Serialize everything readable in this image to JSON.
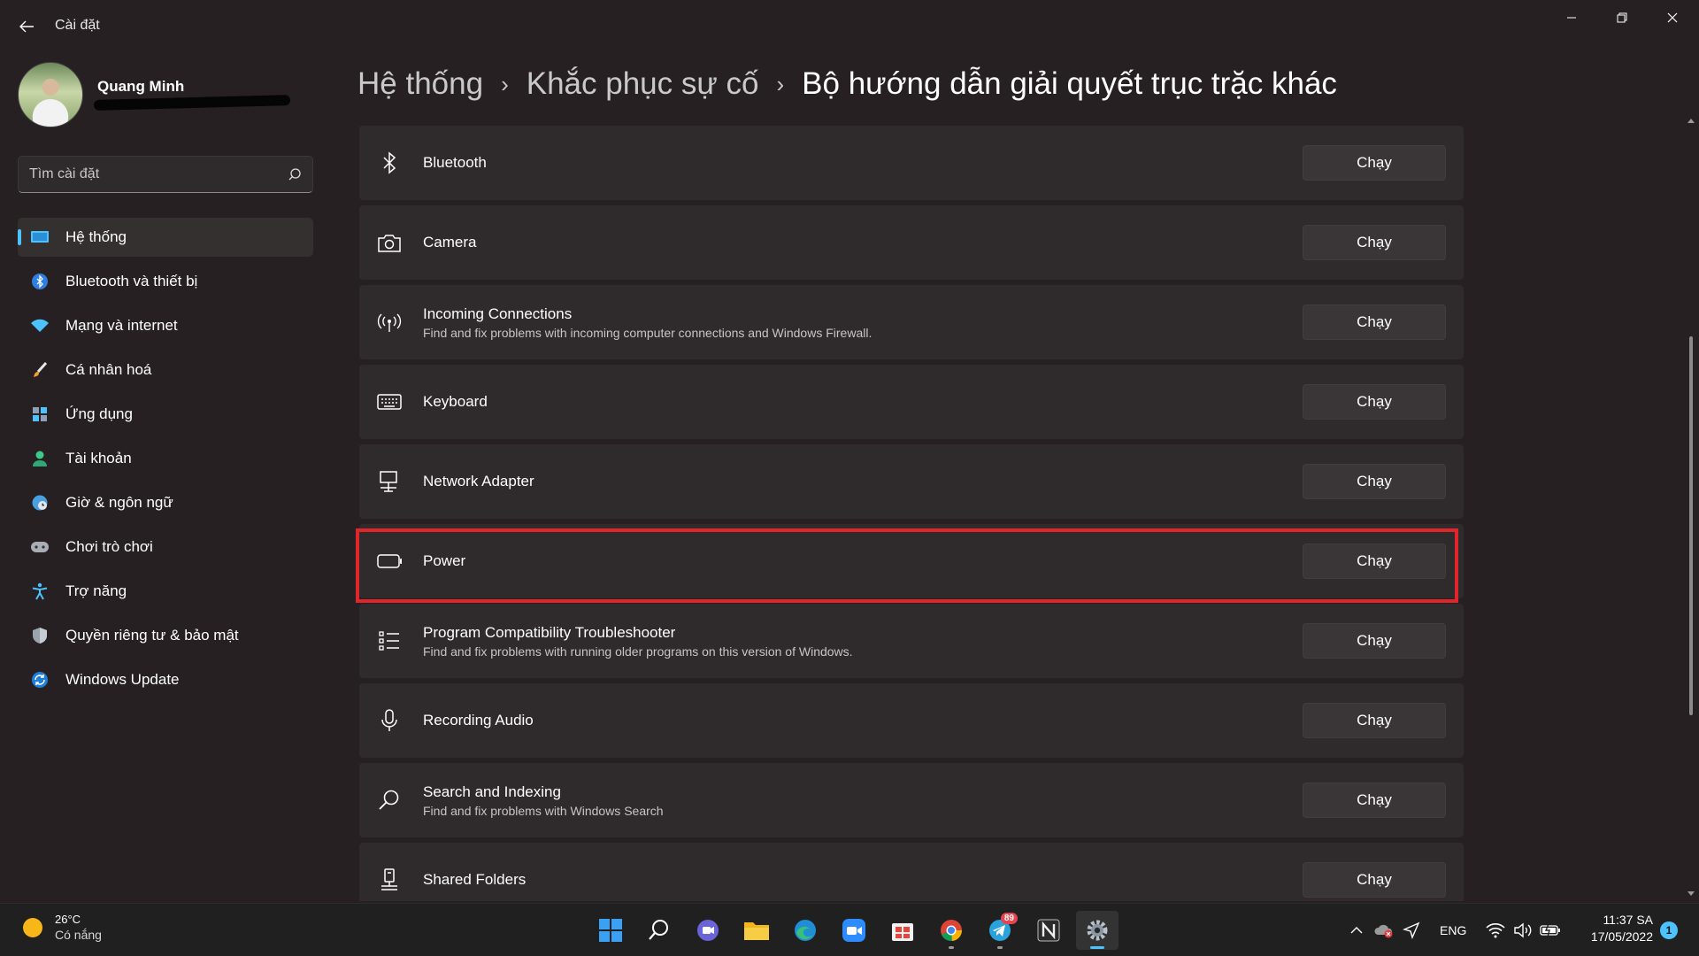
{
  "window": {
    "title": "Cài đặt"
  },
  "profile": {
    "name": "Quang Minh"
  },
  "search": {
    "placeholder": "Tìm cài đặt"
  },
  "nav": {
    "items": [
      {
        "label": "Hệ thống",
        "icon": "monitor-icon",
        "active": true
      },
      {
        "label": "Bluetooth và thiết bị",
        "icon": "bluetooth-icon"
      },
      {
        "label": "Mạng và internet",
        "icon": "wifi-icon"
      },
      {
        "label": "Cá nhân hoá",
        "icon": "brush-icon"
      },
      {
        "label": "Ứng dụng",
        "icon": "apps-icon"
      },
      {
        "label": "Tài khoản",
        "icon": "person-icon"
      },
      {
        "label": "Giờ & ngôn ngữ",
        "icon": "globe-clock-icon"
      },
      {
        "label": "Chơi trò chơi",
        "icon": "gamepad-icon"
      },
      {
        "label": "Trợ năng",
        "icon": "accessibility-icon"
      },
      {
        "label": "Quyền riêng tư & bảo mật",
        "icon": "shield-icon"
      },
      {
        "label": "Windows Update",
        "icon": "update-icon"
      }
    ]
  },
  "breadcrumb": {
    "items": [
      "Hệ thống",
      "Khắc phục sự cố",
      "Bộ hướng dẫn giải quyết trục trặc khác"
    ],
    "separator": "›"
  },
  "troubleshooters": [
    {
      "title": "Bluetooth",
      "desc": "",
      "icon": "bluetooth-icon",
      "button": "Chạy"
    },
    {
      "title": "Camera",
      "desc": "",
      "icon": "camera-icon",
      "button": "Chạy"
    },
    {
      "title": "Incoming Connections",
      "desc": "Find and fix problems with incoming computer connections and Windows Firewall.",
      "icon": "antenna-icon",
      "button": "Chạy"
    },
    {
      "title": "Keyboard",
      "desc": "",
      "icon": "keyboard-icon",
      "button": "Chạy"
    },
    {
      "title": "Network Adapter",
      "desc": "",
      "icon": "network-adapter-icon",
      "button": "Chạy"
    },
    {
      "title": "Power",
      "desc": "",
      "icon": "battery-icon",
      "button": "Chạy",
      "highlighted": true
    },
    {
      "title": "Program Compatibility Troubleshooter",
      "desc": "Find and fix problems with running older programs on this version of Windows.",
      "icon": "list-icon",
      "button": "Chạy"
    },
    {
      "title": "Recording Audio",
      "desc": "",
      "icon": "microphone-icon",
      "button": "Chạy"
    },
    {
      "title": "Search and Indexing",
      "desc": "Find and fix problems with Windows Search",
      "icon": "search-icon",
      "button": "Chạy"
    },
    {
      "title": "Shared Folders",
      "desc": "",
      "icon": "shared-folder-icon",
      "button": "Chạy"
    }
  ],
  "taskbar": {
    "weather": {
      "temp": "26°C",
      "condition": "Có nắng"
    },
    "apps": [
      {
        "name": "start-button",
        "icon": "windows-logo-icon"
      },
      {
        "name": "search-button",
        "icon": "search-icon"
      },
      {
        "name": "teams-chat",
        "icon": "chat-icon"
      },
      {
        "name": "file-explorer",
        "icon": "folder-icon"
      },
      {
        "name": "edge-browser",
        "icon": "edge-icon"
      },
      {
        "name": "zoom-app",
        "icon": "video-camera-icon"
      },
      {
        "name": "store-app",
        "icon": "store-icon"
      },
      {
        "name": "chrome-browser",
        "icon": "chrome-icon"
      },
      {
        "name": "telegram-app",
        "icon": "telegram-icon",
        "badge": "89"
      },
      {
        "name": "notion-app",
        "icon": "notion-icon"
      },
      {
        "name": "settings-app",
        "icon": "gear-icon",
        "active": true
      }
    ],
    "tray": {
      "language": "ENG",
      "time": "11:37 SA",
      "date": "17/05/2022",
      "notifications": "1"
    }
  },
  "colors": {
    "accent": "#4cc2ff",
    "highlight_border": "#e0262b",
    "background": "#272022",
    "card": "#2f2a2b"
  }
}
